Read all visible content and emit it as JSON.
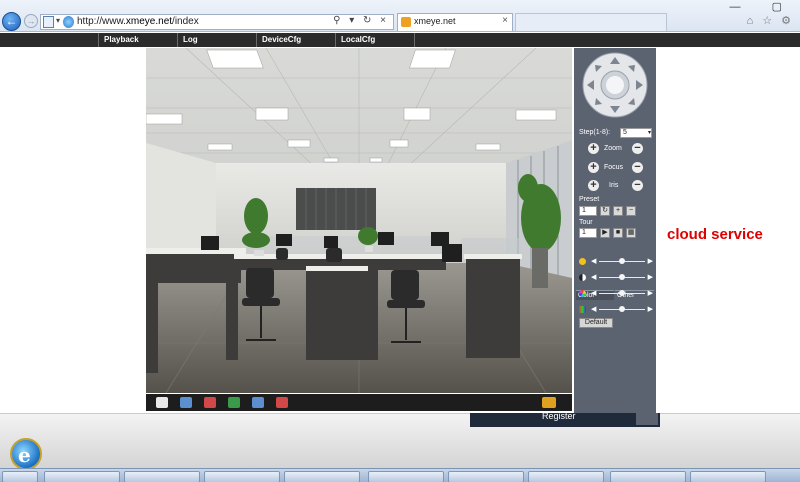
{
  "browser": {
    "url_prefix": "http://www.",
    "url_domain": "xmeye.net",
    "url_path": "/index",
    "tab_title": "xmeye.net",
    "tab_close": "×",
    "back_icon": "back-arrow-icon",
    "forward_icon": "forward-arrow-icon",
    "addr_icons": "⚲ ▾ ↻ ×",
    "window_controls": "— ▢",
    "right_icons": "⌂ ☆ ⚙"
  },
  "nav": {
    "items": [
      {
        "label": "Playback"
      },
      {
        "label": "Log"
      },
      {
        "label": "DeviceCfg"
      },
      {
        "label": "LocalCfg"
      }
    ]
  },
  "ptz": {
    "step_label": "Step(1-8):",
    "step_value": "5",
    "zoom_label": "Zoom",
    "focus_label": "Focus",
    "iris_label": "Iris",
    "preset_label": "Preset",
    "preset_value": "1",
    "tour_label": "Tour",
    "tour_value": "1",
    "color_tab": "Color",
    "other_tab": "Other",
    "sliders": [
      {
        "name": "brightness",
        "value": 0.5
      },
      {
        "name": "contrast",
        "value": 0.5
      },
      {
        "name": "saturation",
        "value": 0.5
      },
      {
        "name": "hue",
        "value": 0.5
      }
    ],
    "default_label": "Default"
  },
  "register_label": "Register",
  "cloud_service_text": "cloud service",
  "colors": {
    "nav_bg": "#2b2b2b",
    "panel_bg": "#5b6370",
    "cloud_text": "#e00000"
  }
}
